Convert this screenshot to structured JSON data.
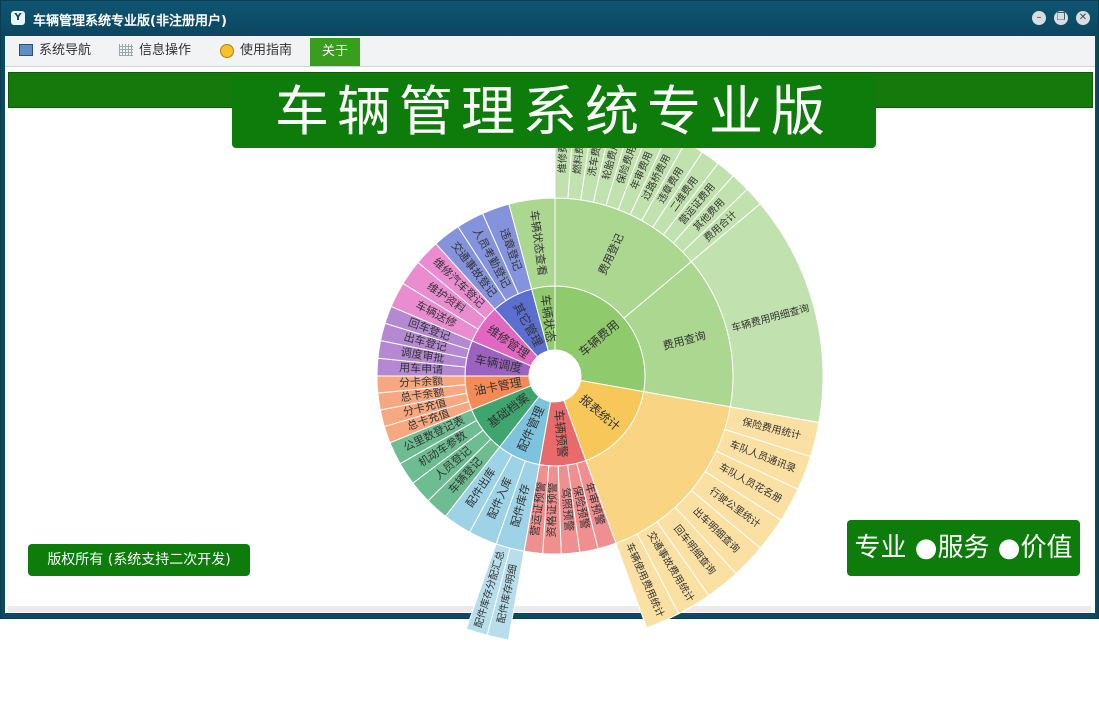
{
  "window": {
    "title": "车辆管理系统专业版(非注册用户)",
    "app_icon": "Y"
  },
  "menu": {
    "nav": "系统导航",
    "info": "信息操作",
    "guide": "使用指南",
    "about": "关于"
  },
  "banner": {
    "title": "车辆管理系统专业版"
  },
  "footer": {
    "copyright": "版权所有 (系统支持二次开发)",
    "slogan": "专业 ●服务 ●价值"
  },
  "icons": [
    "app-logo-icon",
    "minimize-icon",
    "restore-icon",
    "close-icon",
    "monitor-icon",
    "grid-icon",
    "lightbulb-icon"
  ],
  "sunburst": [
    {
      "name": "车辆费用",
      "color": "#8fca6c",
      "children": [
        {
          "name": "费用登记",
          "children": [
            "维修费用",
            "燃料费用",
            "洗车费用",
            "轮胎费用",
            "保险费用",
            "年审费用",
            "过路桥费用",
            "违章费用",
            "二维费用",
            "营运证费用",
            "其他费用",
            "费用合计"
          ]
        },
        {
          "name": "费用查询",
          "children": [
            "车辆费用明细查询"
          ]
        }
      ]
    },
    {
      "name": "报表统计",
      "color": "#f7c75a",
      "children": [
        {
          "name": "",
          "children": [
            "保险费用统计",
            "车队人员通讯录",
            "车队人员花名册",
            "行驶公里统计",
            "出车明细查询",
            "回车明细查询",
            "交通事故费用统计",
            "车辆使用费用统计"
          ]
        }
      ]
    },
    {
      "name": "车辆预警",
      "color": "#e96a6a",
      "children": [
        {
          "name": "年审预警"
        },
        {
          "name": "保险预警"
        },
        {
          "name": "驾照预警"
        },
        {
          "name": "资格证预警"
        },
        {
          "name": "营运证预警"
        }
      ]
    },
    {
      "name": "配件管理",
      "color": "#7ec3dd",
      "children": [
        {
          "name": "配件库存",
          "children": [
            "配件库存明细",
            "配件库存分配汇总"
          ]
        },
        {
          "name": "配件入库"
        },
        {
          "name": "配件出库"
        }
      ]
    },
    {
      "name": "基础档案",
      "color": "#3ea56e",
      "children": [
        {
          "name": "车辆登记"
        },
        {
          "name": "人员登记"
        },
        {
          "name": "机动车参数"
        },
        {
          "name": "公里数登记表"
        }
      ]
    },
    {
      "name": "油卡管理",
      "color": "#f48b56",
      "children": [
        {
          "name": "总卡充值"
        },
        {
          "name": "分卡充值"
        },
        {
          "name": "总卡余额"
        },
        {
          "name": "分卡余额"
        }
      ]
    },
    {
      "name": "车辆调度",
      "color": "#9b62c1",
      "children": [
        {
          "name": "用车申请"
        },
        {
          "name": "调度审批"
        },
        {
          "name": "出车登记"
        },
        {
          "name": "回车登记"
        }
      ]
    },
    {
      "name": "维修管理",
      "color": "#e167c0",
      "children": [
        {
          "name": "车辆送修"
        },
        {
          "name": "维护资料"
        },
        {
          "name": "维修汽车登记"
        }
      ]
    },
    {
      "name": "其它管理",
      "color": "#5b6fd0",
      "children": [
        {
          "name": "交通事故登记"
        },
        {
          "name": "人员考勤登记"
        },
        {
          "name": "违章登记"
        }
      ]
    },
    {
      "name": "车辆状态",
      "color": "#8fca6c",
      "children": [
        {
          "name": "车辆状态查看"
        }
      ]
    }
  ]
}
